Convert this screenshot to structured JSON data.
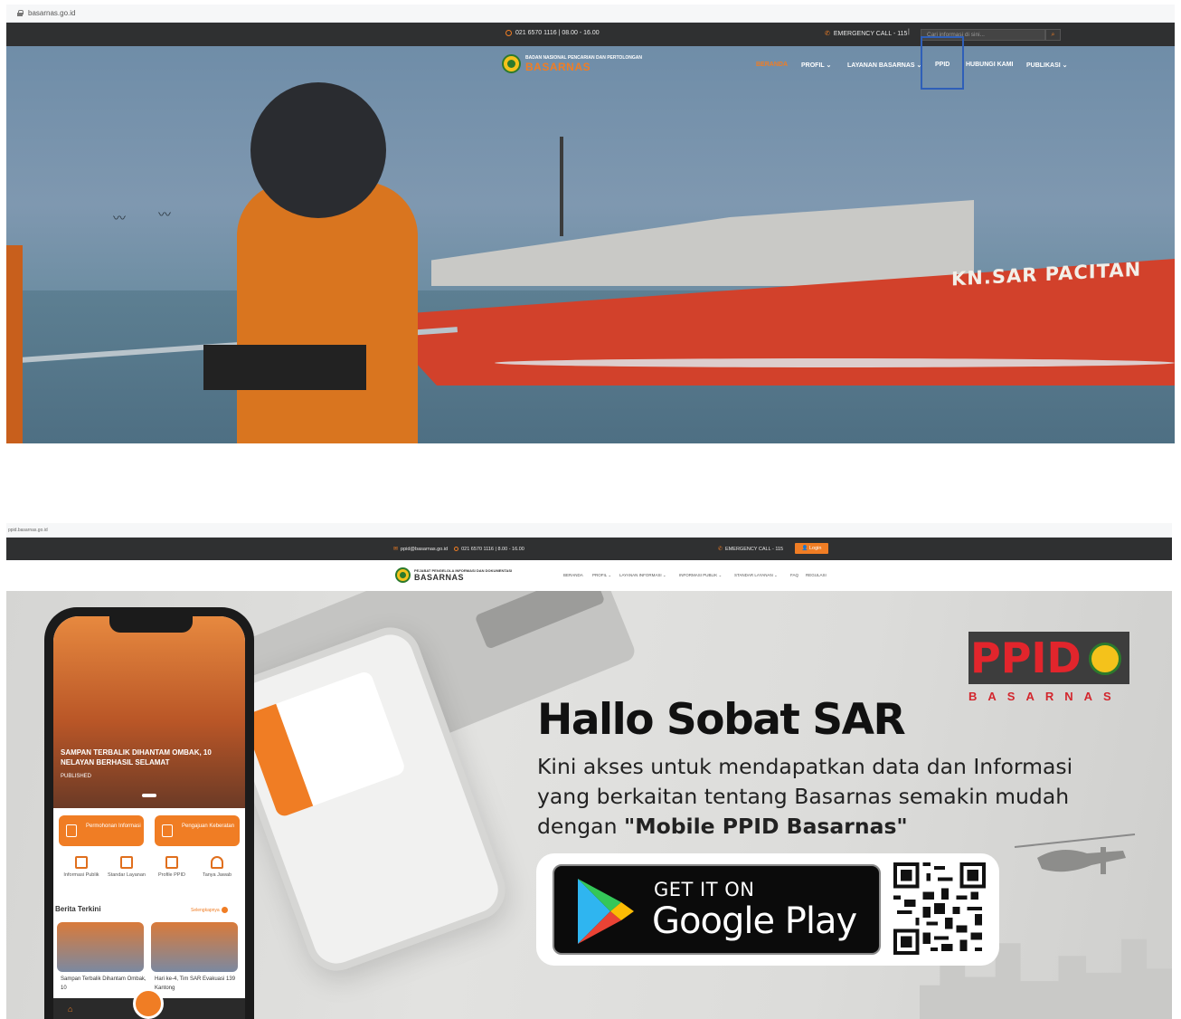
{
  "screen1": {
    "url": "basarnas.go.id",
    "topbar": {
      "hours": "021 6570 1116 | 08.00 - 16.00",
      "emergency": "EMERGENCY CALL - 115",
      "separator": "|",
      "search_placeholder": "Cari informasi di sini..."
    },
    "logo": {
      "subtitle": "BADAN NASIONAL PENCARIAN DAN PERTOLONGAN",
      "title": "BASARNAS"
    },
    "nav": {
      "items": [
        "BERANDA",
        "PROFIL ⌄",
        "LAYANAN BASARNAS ⌄",
        "PPID",
        "HUBUNGI KAMI",
        "PUBLIKASI ⌄"
      ],
      "active_index": 0,
      "highlighted": "PPID"
    },
    "hero": {
      "ship_name": "KN.SAR PACITAN"
    }
  },
  "screen2": {
    "url": "ppid.basarnas.go.id",
    "topbar": {
      "email": "ppid@basarnas.go.id",
      "hours": "021 6570 1116 | 8.00 - 16.00",
      "emergency": "EMERGENCY CALL - 115",
      "login": "Login"
    },
    "logo": {
      "subtitle": "PEJABAT PENGELOLA INFORMASI DAN DOKUMENTASI",
      "title": "BASARNAS"
    },
    "nav": {
      "items": [
        "BERANDA",
        "PROFIL ⌄",
        "LAYANAN INFORMASI ⌄",
        "INFORMASI PUBLIK ⌄",
        "STANDAR LAYANAN ⌄",
        "FAQ",
        "REGULASI"
      ],
      "active_index": 0
    },
    "banner": {
      "headline": "Hallo Sobat SAR",
      "line1": "Kini akses untuk mendapatkan data dan Informasi",
      "line2": "yang berkaitan tentang Basarnas semakin mudah",
      "line3_prefix": "dengan ",
      "line3_bold": "\"Mobile PPID Basarnas\"",
      "ppid_logo": {
        "letters": "PPID",
        "sub": "BASARNAS"
      },
      "store": {
        "top": "GET IT ON",
        "main": "Google Play"
      }
    },
    "phone_app": {
      "hero_title": "SAMPAN TERBALIK DIHANTAM OMBAK, 10 NELAYAN BERHASIL SELAMAT",
      "hero_meta": "PUBLISHED",
      "buttons": [
        "Permohonan Informasi",
        "Pengajuan Keberatan"
      ],
      "menu": [
        "Informasi Publik",
        "Standar Layanan",
        "Profile PPID",
        "Tanya Jawab"
      ],
      "section_title": "Berita Terkini",
      "section_more": "Selengkapnya",
      "news": [
        "Sampan Terbalik Dihantam Ombak, 10",
        "Hari ke-4, Tim SAR Evakuasi 139 Kantong"
      ]
    },
    "accent_color": "#f07d24"
  }
}
